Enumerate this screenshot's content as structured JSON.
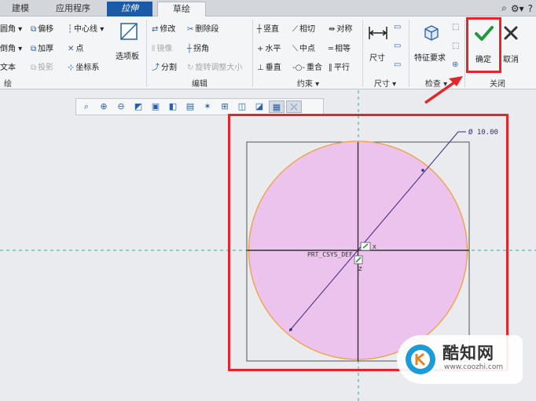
{
  "tabs": [
    {
      "label": "建模"
    },
    {
      "label": "应用程序"
    },
    {
      "label": "拉伸"
    },
    {
      "label": "草绘"
    }
  ],
  "tabbar_icons": [
    "search-icon",
    "settings-icon",
    "help-icon"
  ],
  "ribbon": {
    "setup": {
      "items": [
        "圆角",
        "倒角",
        "文本",
        "偏移",
        "加厚",
        "投影",
        "中心线",
        "点",
        "坐标系"
      ],
      "options_label": "选项板",
      "group_label": "绘"
    },
    "edit": {
      "items": [
        "修改",
        "删除段",
        "镜像",
        "拐角",
        "分割",
        "旋转调整大小"
      ],
      "group_label": "编辑"
    },
    "constrain": {
      "items": [
        "竖直",
        "相切",
        "对称",
        "水平",
        "中点",
        "相等",
        "垂直",
        "重合",
        "平行"
      ],
      "group_label": "约束"
    },
    "dimension": {
      "label": "尺寸",
      "group_label": "尺寸"
    },
    "inspect": {
      "label": "特征要求",
      "group_label": "检查"
    },
    "close": {
      "ok_label": "确定",
      "cancel_label": "取消",
      "group_label": "关闭"
    }
  },
  "view_toolbar": [
    "zoom-fit-icon",
    "zoom-in-icon",
    "zoom-out-icon",
    "repaint-icon",
    "display-style-icon",
    "saved-views-icon",
    "annotation-display-icon",
    "datum-display-icon",
    "spin-center-icon",
    "sketch-view-icon",
    "sketcher-display-icon",
    "grid-display-icon",
    "dim-display-icon"
  ],
  "sketch": {
    "diameter_label": "Ø 10.00",
    "csys_label": "PRT_CSYS_DEF",
    "x_axis_label": "X",
    "z_axis_label": "Z",
    "fill_color": "#ecc3ec",
    "outline_color": "#f0a040"
  },
  "watermark": {
    "title": "酷知网",
    "url": "www.coozhi.com"
  }
}
